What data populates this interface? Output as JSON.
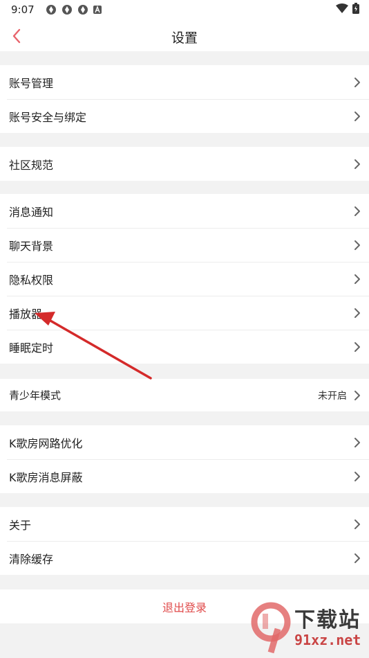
{
  "status_bar": {
    "time": "9:07"
  },
  "header": {
    "title": "设置"
  },
  "groups": [
    {
      "items": [
        {
          "label": "账号管理"
        },
        {
          "label": "账号安全与绑定"
        }
      ]
    },
    {
      "items": [
        {
          "label": "社区规范"
        }
      ]
    },
    {
      "items": [
        {
          "label": "消息通知"
        },
        {
          "label": "聊天背景"
        },
        {
          "label": "隐私权限"
        },
        {
          "label": "播放器"
        },
        {
          "label": "睡眠定时"
        }
      ]
    },
    {
      "items": [
        {
          "label": "青少年模式",
          "value": "未开启"
        }
      ]
    },
    {
      "items": [
        {
          "label": "K歌房网路优化"
        },
        {
          "label": "K歌房消息屏蔽"
        }
      ]
    },
    {
      "items": [
        {
          "label": "关于"
        },
        {
          "label": "清除缓存"
        }
      ]
    }
  ],
  "logout": {
    "label": "退出登录"
  },
  "watermark": {
    "brand": "下载站",
    "site": "91xz.net"
  },
  "colors": {
    "accent": "#e04a4a",
    "arrow": "#d42a2a"
  }
}
